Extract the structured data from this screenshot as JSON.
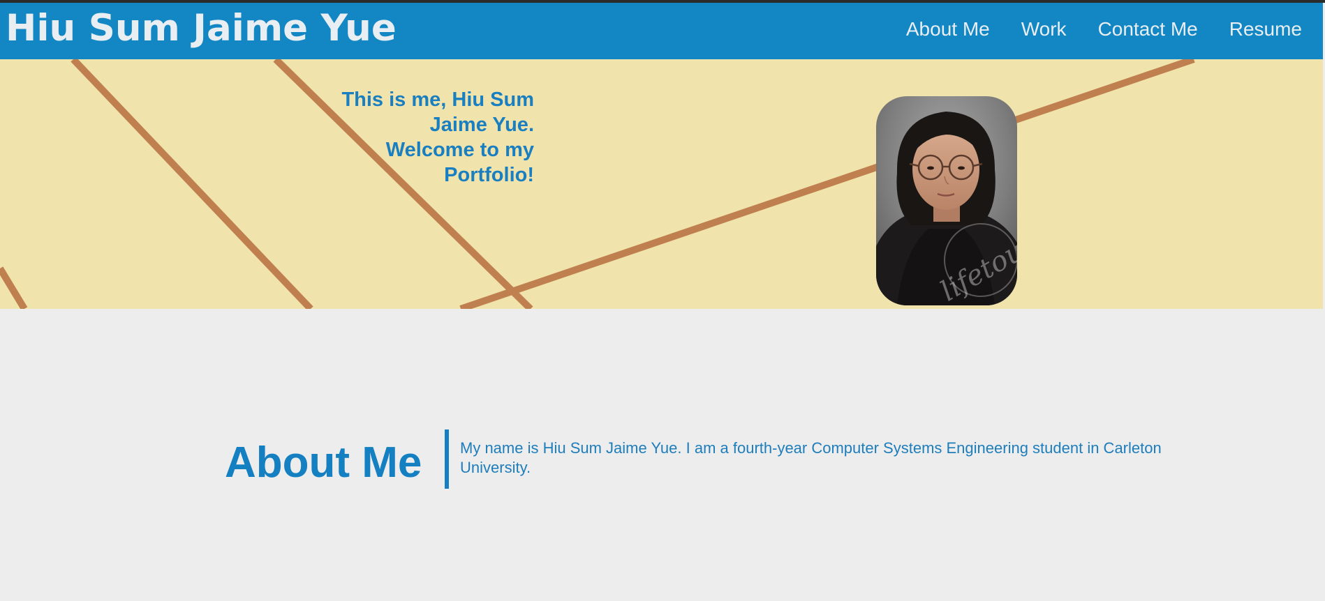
{
  "header": {
    "site_title": "Hiu Sum Jaime Yue",
    "nav": [
      {
        "label": "About Me"
      },
      {
        "label": "Work"
      },
      {
        "label": "Contact Me"
      },
      {
        "label": "Resume"
      }
    ]
  },
  "hero": {
    "intro_lines": [
      "This is me, Hiu Sum",
      "Jaime Yue.",
      "Welcome to my",
      "Portfolio!"
    ],
    "portrait_icon": "portrait-photo",
    "watermark": "lifetouch"
  },
  "about": {
    "heading": "About Me",
    "body": "My name is Hiu Sum Jaime Yue. I am a fourth-year Computer Systems Engineering student in Carleton University."
  },
  "colors": {
    "header_bg": "#1287c4",
    "header_text": "#e9eef2",
    "hero_bg": "#f0e3ac",
    "hero_lines": "#bf7f4e",
    "accent": "#1480c1",
    "page_bg": "#ededed"
  }
}
